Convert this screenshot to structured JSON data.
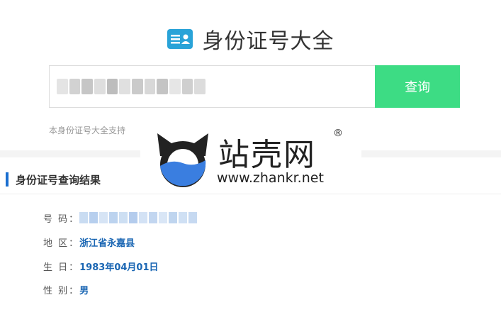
{
  "header": {
    "title": "身份证号大全",
    "icon": "id-card-icon"
  },
  "search": {
    "value_obscured": true,
    "button_label": "查询"
  },
  "tip": {
    "text": "本身份证号大全支持"
  },
  "result": {
    "title": "身份证号查询结果",
    "rows": [
      {
        "label": "号 码：",
        "value": ""
      },
      {
        "label": "地 区：",
        "value": "浙江省永嘉县"
      },
      {
        "label": "生 日：",
        "value": "1983年04月01日"
      },
      {
        "label": "性 别：",
        "value": "男"
      }
    ]
  },
  "watermark": {
    "name": "站壳网",
    "registered": "®",
    "url": "www.zhankr.net"
  },
  "colors": {
    "accent_green": "#3ddc84",
    "link_blue": "#1a66b3",
    "icon_blue": "#29a3d8",
    "logo_blue": "#3a7ee0"
  }
}
